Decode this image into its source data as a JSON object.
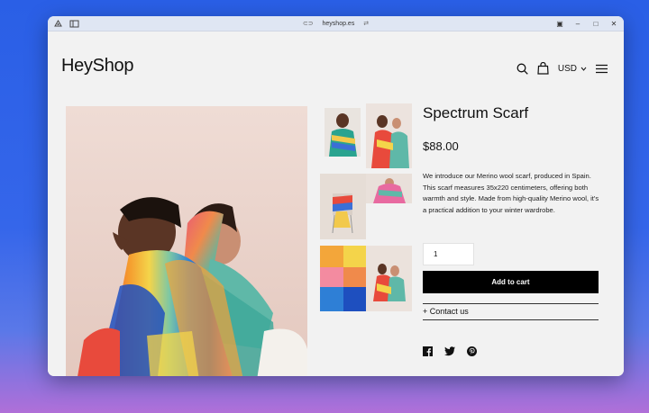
{
  "browser": {
    "url": "heyshop.es"
  },
  "store": {
    "logo": "HeyShop",
    "currency": "USD"
  },
  "product": {
    "title": "Spectrum Scarf",
    "price": "$88.00",
    "description": "We introduce our Merino wool scarf, produced in Spain. This scarf measures 35x220 centimeters, offering both warmth and style. Made from high-quality Merino wool, it's a practical addition to your winter wardrobe.",
    "quantity": "1",
    "add_to_cart_label": "Add to cart",
    "contact_label": "+ Contact us"
  },
  "icons": {
    "search": "search-icon",
    "cart": "bag-icon",
    "menu": "hamburger-menu-icon",
    "social": [
      "facebook-icon",
      "twitter-icon",
      "pinterest-icon"
    ]
  }
}
